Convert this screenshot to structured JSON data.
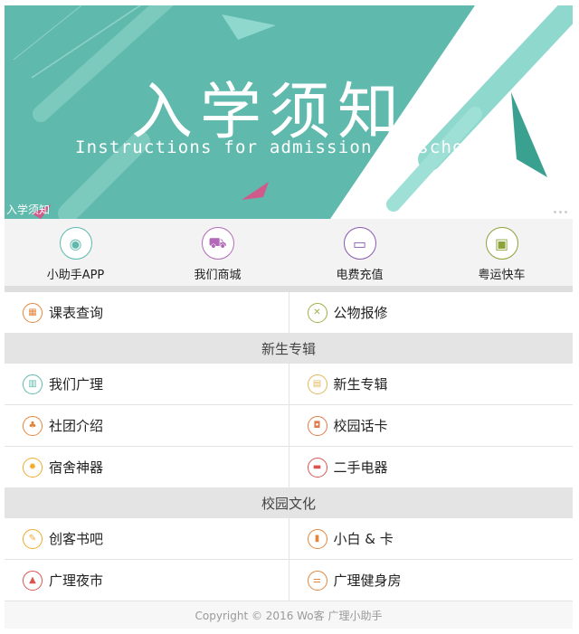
{
  "banner": {
    "title": "入学须知",
    "subtitle": "Instructions for admission to school",
    "caption": "入学须知"
  },
  "quick_links": [
    {
      "label": "小助手APP",
      "icon": "owl-icon",
      "glyph": "◉",
      "color": "#5fb9ad"
    },
    {
      "label": "我们商城",
      "icon": "cart-icon",
      "glyph": "⛟",
      "color": "#b26ab8"
    },
    {
      "label": "电费充值",
      "icon": "battery-icon",
      "glyph": "▭",
      "color": "#8a5bb1"
    },
    {
      "label": "粤运快车",
      "icon": "bus-icon",
      "glyph": "▣",
      "color": "#8ca23a"
    }
  ],
  "top_rows": [
    [
      {
        "label": "课表查询",
        "icon": "calendar-icon",
        "glyph": "▦",
        "color": "#e3863c"
      },
      {
        "label": "公物报修",
        "icon": "wrench-icon",
        "glyph": "✕",
        "color": "#9bb043"
      }
    ]
  ],
  "sections": [
    {
      "title": "新生专辑",
      "rows": [
        [
          {
            "label": "我们广理",
            "icon": "buildings-icon",
            "glyph": "▥",
            "color": "#5fb9ad"
          },
          {
            "label": "新生专辑",
            "icon": "book-icon",
            "glyph": "▤",
            "color": "#e0b85a"
          }
        ],
        [
          {
            "label": "社团介绍",
            "icon": "group-icon",
            "glyph": "♣",
            "color": "#e3863c"
          },
          {
            "label": "校园话卡",
            "icon": "card-icon",
            "glyph": "◘",
            "color": "#e07a4a"
          }
        ],
        [
          {
            "label": "宿舍神器",
            "icon": "sun-icon",
            "glyph": "✹",
            "color": "#efaa2a"
          },
          {
            "label": "二手电器",
            "icon": "laptop-icon",
            "glyph": "▬",
            "color": "#d9534f"
          }
        ]
      ]
    },
    {
      "title": "校园文化",
      "rows": [
        [
          {
            "label": "创客书吧",
            "icon": "palette-icon",
            "glyph": "✎",
            "color": "#efaa2a"
          },
          {
            "label": "小白 & 卡",
            "icon": "book-open-icon",
            "glyph": "▮",
            "color": "#e3863c"
          }
        ],
        [
          {
            "label": "广理夜市",
            "icon": "tent-icon",
            "glyph": "▲",
            "color": "#d9534f"
          },
          {
            "label": "广理健身房",
            "icon": "dumbbell-icon",
            "glyph": "⚌",
            "color": "#e3863c"
          }
        ]
      ]
    }
  ],
  "footer": "Copyright © 2016 Wo客 广理小助手"
}
